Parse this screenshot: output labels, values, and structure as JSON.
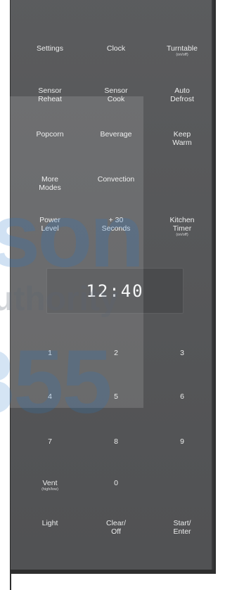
{
  "keypad": {
    "rows": [
      [
        {
          "label": "Settings",
          "sub": ""
        },
        {
          "label": "Clock",
          "sub": ""
        },
        {
          "label": "Turntable",
          "sub": "(on/off)"
        }
      ],
      [
        {
          "label": "Sensor\nReheat",
          "sub": ""
        },
        {
          "label": "Sensor\nCook",
          "sub": ""
        },
        {
          "label": "Auto\nDefrost",
          "sub": ""
        }
      ],
      [
        {
          "label": "Popcorn",
          "sub": ""
        },
        {
          "label": "Beverage",
          "sub": ""
        },
        {
          "label": "Keep\nWarm",
          "sub": ""
        }
      ],
      [
        {
          "label": "More\nModes",
          "sub": ""
        },
        {
          "label": "Convection",
          "sub": ""
        },
        null
      ],
      [
        {
          "label": "Power\nLevel",
          "sub": ""
        },
        {
          "label": "+ 30\nSeconds",
          "sub": ""
        },
        {
          "label": "Kitchen\nTimer",
          "sub": "(on/off)"
        }
      ]
    ],
    "numbers": [
      [
        {
          "label": "1"
        },
        {
          "label": "2"
        },
        {
          "label": "3"
        }
      ],
      [
        {
          "label": "4"
        },
        {
          "label": "5"
        },
        {
          "label": "6"
        }
      ],
      [
        {
          "label": "7"
        },
        {
          "label": "8"
        },
        {
          "label": "9"
        }
      ],
      [
        {
          "label": "Vent",
          "sub": "(high/low)"
        },
        {
          "label": "0"
        },
        null
      ],
      [
        {
          "label": "Light"
        },
        {
          "label": "Clear/\nOff"
        },
        {
          "label": "Start/\nEnter"
        }
      ]
    ]
  },
  "display": {
    "time": "12:40"
  },
  "watermark": {
    "line1": "son",
    "line2": "uthority",
    "line3": "355"
  },
  "colors": {
    "panel": "#545557",
    "text": "#eceded",
    "display_bg": "#4a4b4d"
  }
}
